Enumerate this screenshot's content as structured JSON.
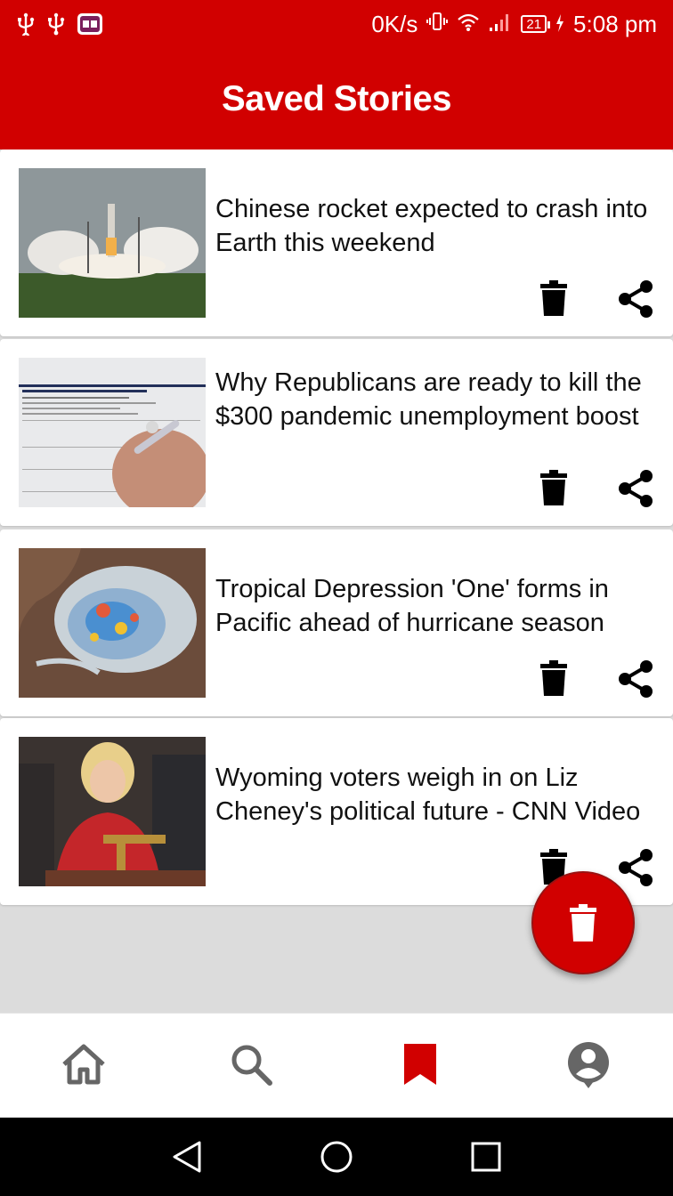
{
  "status_bar": {
    "left_icons": [
      "usb-icon",
      "usb-icon",
      "book-app-icon"
    ],
    "net_speed": "0K/s",
    "battery_level": "21",
    "time": "5:08 pm"
  },
  "app_bar": {
    "title": "Saved Stories"
  },
  "stories": [
    {
      "title": "Chinese rocket expected to crash into Earth this weekend"
    },
    {
      "title": "Why Republicans are ready to kill the $300 pandemic unemployment boost"
    },
    {
      "title": "Tropical Depression 'One' forms in Pacific ahead of hurricane season"
    },
    {
      "title": "Wyoming voters weigh in on Liz Cheney's political future - CNN Video"
    }
  ],
  "bottom_nav": {
    "items": [
      "home-icon",
      "search-icon",
      "bookmark-icon",
      "account-icon"
    ],
    "active": "bookmark-icon"
  },
  "colors": {
    "accent": "#d10000",
    "inactive_icon": "#666666",
    "background": "#dcdcdc"
  }
}
